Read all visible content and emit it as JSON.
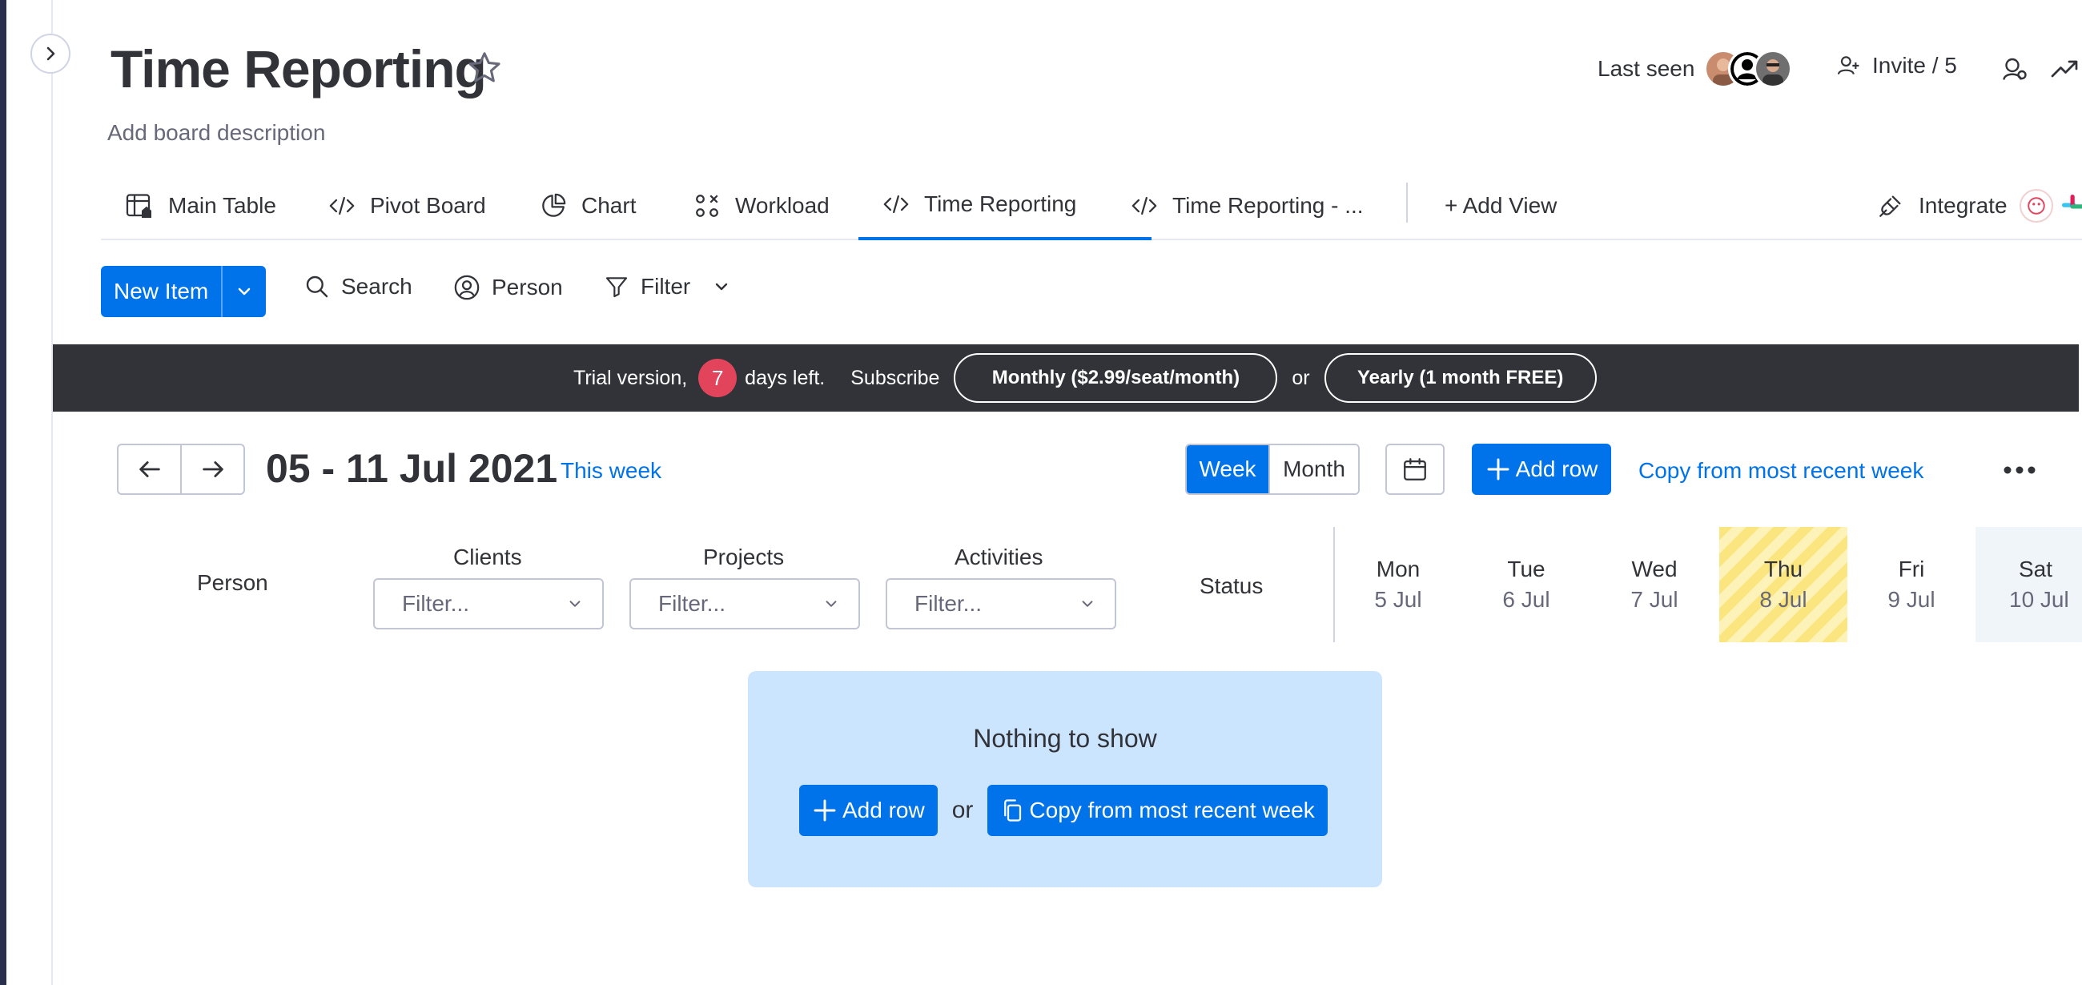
{
  "board": {
    "title": "Time Reporting",
    "description": "Add board description"
  },
  "header": {
    "last_seen_label": "Last seen",
    "invite_label": "Invite / 5"
  },
  "tabs": [
    {
      "label": "Main Table",
      "icon": "table-home-icon"
    },
    {
      "label": "Pivot Board",
      "icon": "code-icon"
    },
    {
      "label": "Chart",
      "icon": "pie-chart-icon"
    },
    {
      "label": "Workload",
      "icon": "workload-icon"
    },
    {
      "label": "Time Reporting",
      "icon": "code-icon",
      "active": true
    },
    {
      "label": "Time Reporting - ...",
      "icon": "code-icon"
    }
  ],
  "add_view_label": "+ Add View",
  "integrate_label": "Integrate",
  "toolbar": {
    "new_item_label": "New Item",
    "search_label": "Search",
    "person_label": "Person",
    "filter_label": "Filter"
  },
  "banner": {
    "trial_prefix": "Trial version,",
    "days_left": "7",
    "trial_suffix": "days left.",
    "subscribe_label": "Subscribe",
    "monthly_label": "Monthly ($2.99/seat/month)",
    "or_label": "or",
    "yearly_label": "Yearly (1 month FREE)"
  },
  "timesheet": {
    "date_range": "05 - 11 Jul 2021",
    "this_week_label": "This week",
    "week_label": "Week",
    "month_label": "Month",
    "add_row_label": "Add row",
    "copy_label": "Copy from most recent week"
  },
  "columns": {
    "person": "Person",
    "clients": "Clients",
    "projects": "Projects",
    "activities": "Activities",
    "status": "Status",
    "filter_placeholder": "Filter..."
  },
  "days": [
    {
      "name": "Mon",
      "date": "5 Jul"
    },
    {
      "name": "Tue",
      "date": "6 Jul"
    },
    {
      "name": "Wed",
      "date": "7 Jul"
    },
    {
      "name": "Thu",
      "date": "8 Jul",
      "today": true
    },
    {
      "name": "Fri",
      "date": "9 Jul"
    },
    {
      "name": "Sat",
      "date": "10 Jul",
      "weekend": true
    }
  ],
  "empty_state": {
    "title": "Nothing to show",
    "add_row_label": "Add row",
    "or_label": "or",
    "copy_label": "Copy from most recent week"
  },
  "colors": {
    "primary": "#0073ea",
    "banner_bg": "#323338",
    "badge_red": "#e2445c",
    "today_yellow": "#fbe57f",
    "empty_bg": "#cce5ff"
  }
}
